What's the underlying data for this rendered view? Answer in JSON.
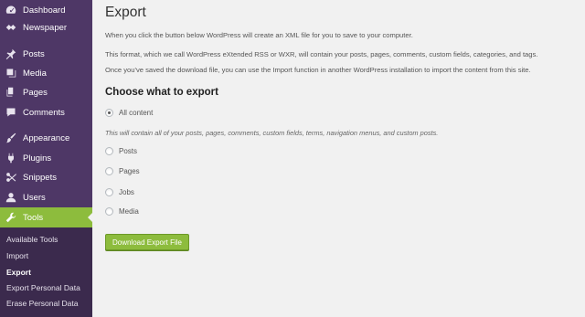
{
  "sidebar": {
    "items": [
      {
        "label": "Dashboard",
        "icon": "dashboard-icon"
      },
      {
        "label": "Newspaper",
        "icon": "newspaper-icon"
      },
      {
        "label": "Posts",
        "icon": "pin-icon"
      },
      {
        "label": "Media",
        "icon": "media-icon"
      },
      {
        "label": "Pages",
        "icon": "pages-icon"
      },
      {
        "label": "Comments",
        "icon": "comment-icon"
      },
      {
        "label": "Appearance",
        "icon": "brush-icon"
      },
      {
        "label": "Plugins",
        "icon": "plug-icon"
      },
      {
        "label": "Snippets",
        "icon": "snippets-icon"
      },
      {
        "label": "Users",
        "icon": "user-icon"
      },
      {
        "label": "Tools",
        "icon": "wrench-icon"
      }
    ],
    "submenu": [
      "Available Tools",
      "Import",
      "Export",
      "Export Personal Data",
      "Erase Personal Data"
    ],
    "colors": {
      "background": "#4e3766",
      "active": "#8dbc3d",
      "submenu": "#3b2a4d"
    }
  },
  "main": {
    "title": "Export",
    "paragraphs": [
      "When you click the button below WordPress will create an XML file for you to save to your computer.",
      "This format, which we call WordPress eXtended RSS or WXR, will contain your posts, pages, comments, custom fields, categories, and tags.",
      "Once you've saved the download file, you can use the Import function in another WordPress installation to import the content from this site."
    ],
    "section_heading": "Choose what to export",
    "options": [
      "All content",
      "Posts",
      "Pages",
      "Jobs",
      "Media"
    ],
    "selected_option": "All content",
    "hint": "This will contain all of your posts, pages, comments, custom fields, terms, navigation menus, and custom posts.",
    "button_label": "Download Export File",
    "button_color": "#8dbc3d"
  }
}
